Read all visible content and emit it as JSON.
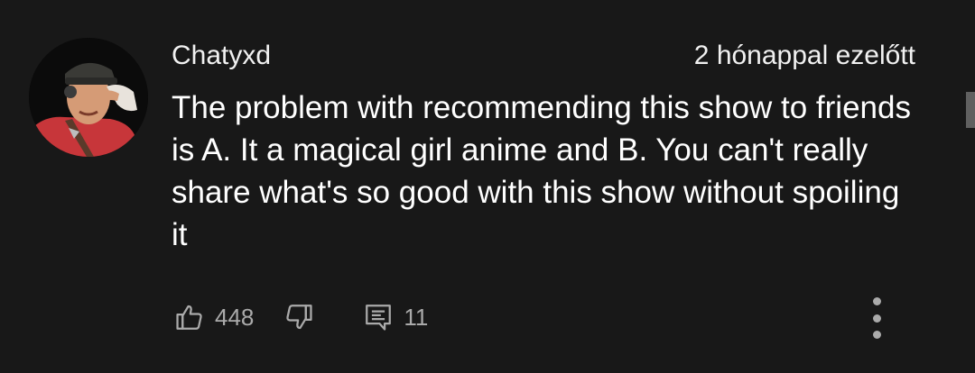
{
  "comment": {
    "author": "Chatyxd",
    "time": "2 hónappal ezelőtt",
    "text": "The problem with recommending this show to friends is A. It a magical girl anime and B. You can't really share what's so good with this show without spoiling it",
    "likes": "448",
    "replies": "11"
  },
  "icons": {
    "like": "thumbs-up-icon",
    "dislike": "thumbs-down-icon",
    "reply": "comment-icon",
    "more": "more-vertical-icon"
  },
  "colors": {
    "background": "#181818",
    "text": "#ffffff",
    "secondary": "#aaaaaa"
  }
}
